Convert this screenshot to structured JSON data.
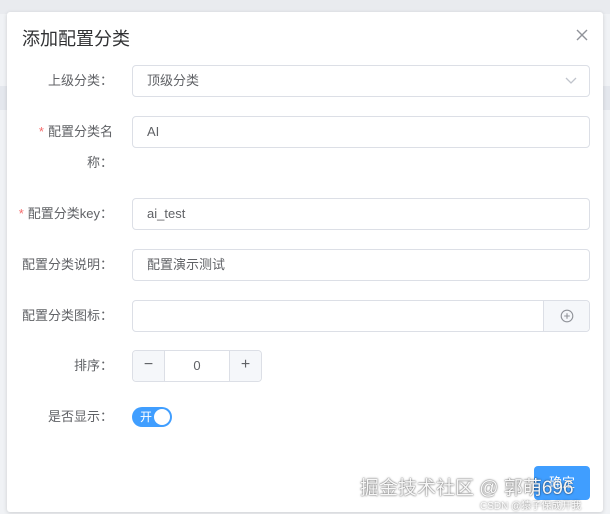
{
  "dialog": {
    "title": "添加配置分类",
    "close_icon": "close-icon"
  },
  "form": {
    "parent": {
      "label": "上级分类：",
      "value": "顶级分类"
    },
    "name": {
      "required": "*",
      "label_line1": "配置分类名",
      "label_line2": "称：",
      "value": "AI"
    },
    "key": {
      "required": "*",
      "label": "配置分类key：",
      "value": "ai_test"
    },
    "desc": {
      "label": "配置分类说明：",
      "value": "配置演示测试"
    },
    "icon": {
      "label": "配置分类图标：",
      "value": ""
    },
    "sort": {
      "label": "排序：",
      "value": "0",
      "minus": "−",
      "plus": "+"
    },
    "show": {
      "label": "是否显示：",
      "switch_text": "开",
      "checked": true
    }
  },
  "footer": {
    "confirm_label": "确定"
  },
  "watermark": {
    "main": "掘金技术社区 @ 郭萌696",
    "sub": "CSDN @猿子保成开我"
  },
  "colors": {
    "primary": "#409eff",
    "required": "#f56c6c"
  }
}
